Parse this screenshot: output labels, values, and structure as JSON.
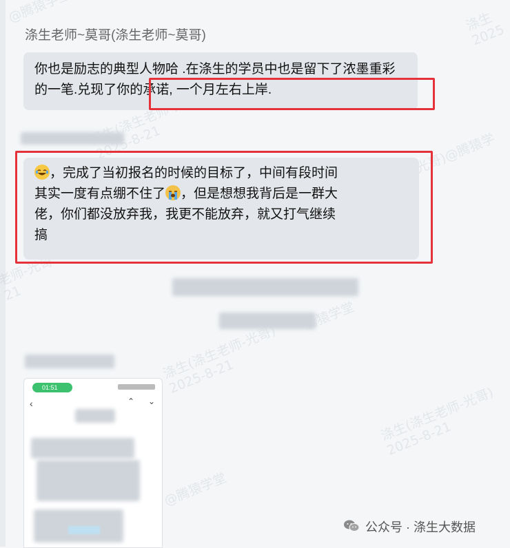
{
  "chat": {
    "sender_name": "涤生老师~莫哥(涤生老师~莫哥)",
    "message1": {
      "text_before": "你也是励志的典型人物哈 .在涤生的学员中也是留下了浓墨重彩的一笔.",
      "text_highlight": "兑现了你的承诺, 一个月左右上岸."
    },
    "message2": {
      "line1_after_emoji": "，完成了当初报名的时候的目标了，中间有段时间",
      "line2_before_emoji": "其实一度有点绷不住了",
      "line2_after_emoji": "，但是想想我背后是一群大",
      "line3": "佬，你们都没放弃我，我更不能放弃，就又打气继续",
      "line4": "搞"
    }
  },
  "watermarks": {
    "top_left": "@腾猿学堂",
    "date_1": "涤生(涤生老师-光哥)\n2025-8-21",
    "date_2": "涤生(涤生老师-光哥)\n2025-8-21",
    "date_3": "涤生(涤生老师-光哥)\n2025-8-21",
    "right_mid": "光哥)@腾猿学",
    "left_mid": "老师-光哥\n21",
    "brand_2": "@腾猿学堂",
    "brand_3": "腾猿学堂",
    "top_right": "涤生\n2025"
  },
  "phone_preview": {
    "call_time": "01:51"
  },
  "footer": {
    "text": "公众号 · 涤生大数据",
    "icon": "wechat-icon"
  },
  "colors": {
    "highlight_border": "#e5323a",
    "bubble_bg": "#e3e6ea",
    "background": "#f4f6f8",
    "call_pill": "#3cc26f"
  }
}
